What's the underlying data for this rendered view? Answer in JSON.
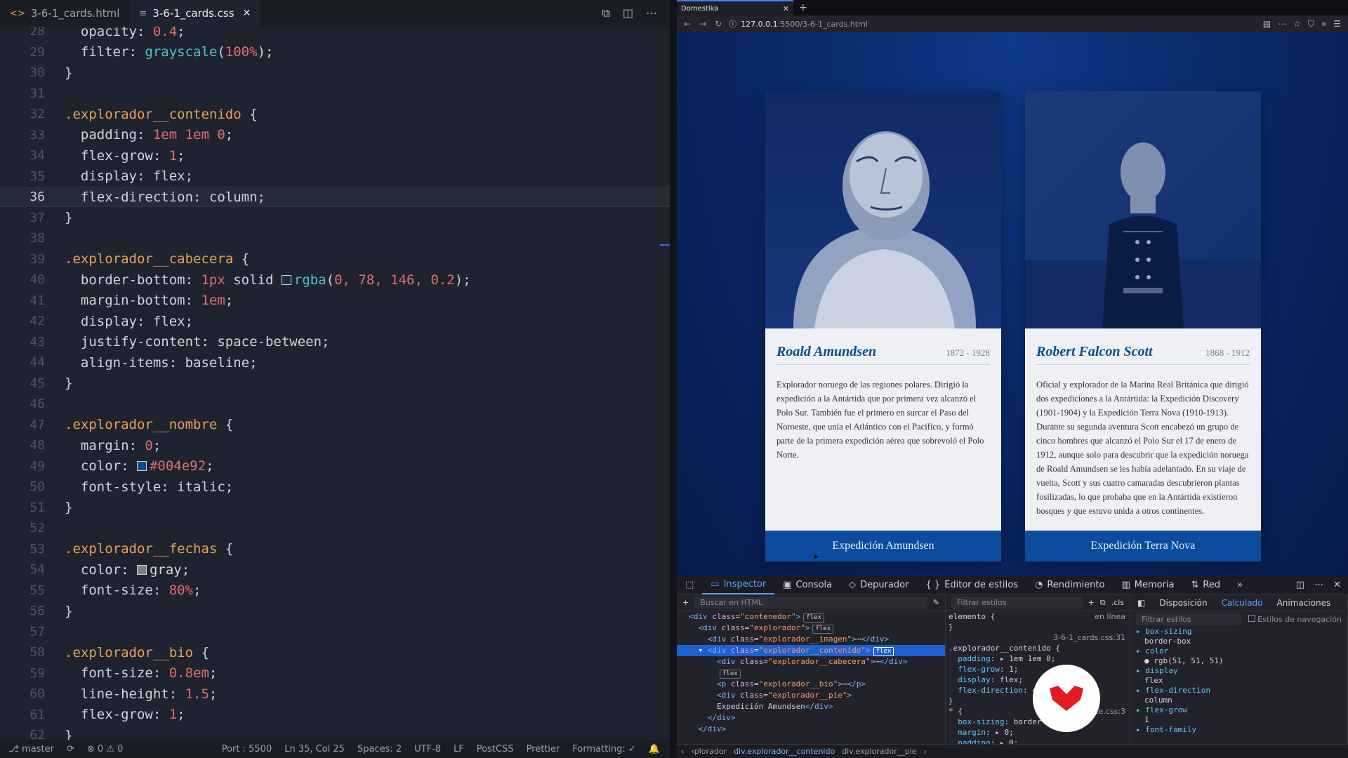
{
  "editor": {
    "tabs": [
      {
        "label": "3-6-1_cards.html",
        "active": false
      },
      {
        "label": "3-6-1_cards.css",
        "active": true
      }
    ],
    "lines": [
      {
        "n": "28",
        "html": "<span class='prop'>  opacity: </span><span class='num'>0.4</span><span class='br'>;</span>"
      },
      {
        "n": "29",
        "html": "<span class='prop'>  filter: </span><span class='fn'>grayscale</span><span class='br'>(</span><span class='num'>100%</span><span class='br'>);</span>"
      },
      {
        "n": "30",
        "html": "<span class='br'>}</span>"
      },
      {
        "n": "31",
        "html": ""
      },
      {
        "n": "32",
        "html": "<span class='sel'>.explorador__contenido</span><span class='br'> {</span>"
      },
      {
        "n": "33",
        "html": "<span class='prop'>  padding: </span><span class='num'>1em 1em 0</span><span class='br'>;</span>"
      },
      {
        "n": "34",
        "html": "<span class='prop'>  flex-grow: </span><span class='num'>1</span><span class='br'>;</span>"
      },
      {
        "n": "35",
        "html": "<span class='prop'>  display: flex;</span>"
      },
      {
        "n": "36",
        "html": "<span class='prop'>  flex-direction: column;</span>",
        "current": true
      },
      {
        "n": "37",
        "html": "<span class='br'>}</span>"
      },
      {
        "n": "38",
        "html": ""
      },
      {
        "n": "39",
        "html": "<span class='sel'>.explorador__cabecera</span><span class='br'> {</span>"
      },
      {
        "n": "40",
        "html": "<span class='prop'>  border-bottom: </span><span class='num'>1px</span><span class='prop'> solid </span><span class='swatch' style='background:rgba(0,78,146,0.2)'></span><span class='fn'>rgba</span><span class='br'>(</span><span class='num'>0, 78, 146, 0.2</span><span class='br'>);</span>"
      },
      {
        "n": "41",
        "html": "<span class='prop'>  margin-bottom: </span><span class='num'>1em</span><span class='br'>;</span>"
      },
      {
        "n": "42",
        "html": "<span class='prop'>  display: flex;</span>"
      },
      {
        "n": "43",
        "html": "<span class='prop'>  justify-content: space-between;</span>"
      },
      {
        "n": "44",
        "html": "<span class='prop'>  align-items: baseline;</span>"
      },
      {
        "n": "45",
        "html": "<span class='br'>}</span>"
      },
      {
        "n": "46",
        "html": ""
      },
      {
        "n": "47",
        "html": "<span class='sel'>.explorador__nombre</span><span class='br'> {</span>"
      },
      {
        "n": "48",
        "html": "<span class='prop'>  margin: </span><span class='num'>0</span><span class='br'>;</span>"
      },
      {
        "n": "49",
        "html": "<span class='prop'>  color: </span><span class='swatch' style='background:#004e92'></span><span class='num'>#004e92</span><span class='br'>;</span>"
      },
      {
        "n": "50",
        "html": "<span class='prop'>  font-style: italic;</span>"
      },
      {
        "n": "51",
        "html": "<span class='br'>}</span>"
      },
      {
        "n": "52",
        "html": ""
      },
      {
        "n": "53",
        "html": "<span class='sel'>.explorador__fechas</span><span class='br'> {</span>"
      },
      {
        "n": "54",
        "html": "<span class='prop'>  color: </span><span class='swatch' style='background:gray'></span><span class='prop'>gray;</span>"
      },
      {
        "n": "55",
        "html": "<span class='prop'>  font-size: </span><span class='num'>80%</span><span class='br'>;</span>"
      },
      {
        "n": "56",
        "html": "<span class='br'>}</span>"
      },
      {
        "n": "57",
        "html": ""
      },
      {
        "n": "58",
        "html": "<span class='sel'>.explorador__bio</span><span class='br'> {</span>"
      },
      {
        "n": "59",
        "html": "<span class='prop'>  font-size: </span><span class='num'>0.8em</span><span class='br'>;</span>"
      },
      {
        "n": "60",
        "html": "<span class='prop'>  line-height: </span><span class='num'>1.5</span><span class='br'>;</span>"
      },
      {
        "n": "61",
        "html": "<span class='prop'>  flex-grow: </span><span class='num'>1</span><span class='br'>;</span>"
      },
      {
        "n": "62",
        "html": "<span class='br'>}</span>"
      }
    ],
    "status": {
      "branch": "master",
      "errors": "0",
      "warnings": "0",
      "port": "Port : 5500",
      "cursor": "Ln 35, Col 25",
      "spaces": "Spaces: 2",
      "encoding": "UTF-8",
      "eol": "LF",
      "language": "PostCSS",
      "formatter": "Prettier",
      "formatting": "Formatting: ✓"
    }
  },
  "browser": {
    "tab_title": "Domestika",
    "url_host": "127.0.0.1",
    "url_path": ":5500/3-6-1_cards.html",
    "cards": [
      {
        "name": "Roald Amundsen",
        "dates": "1872 - 1928",
        "bio": "Explorador noruego de las regiones polares. Dirigió la expedición a la Antártida que por primera vez alcanzó el Polo Sur. También fue el primero en surcar el Paso del Noroeste, que unía el Atlántico con el Pacífico, y formó parte de la primera expedición aérea que sobrevoló el Polo Norte.",
        "footer": "Expedición Amundsen"
      },
      {
        "name": "Robert Falcon Scott",
        "dates": "1868 - 1912",
        "bio": "Oficial y explorador de la Marina Real Británica que dirigió dos expediciones a la Antártida: la Expedición Discovery (1901-1904) y la Expedición Terra Nova (1910-1913). Durante su segunda aventura Scott encabezó un grupo de cinco hombres que alcanzó el Polo Sur el 17 de enero de 1912, aunque solo para descubrir que la expedición noruega de Roald Amundsen se les había adelantado. En su viaje de vuelta, Scott y sus cuatro camaradas descubrieron plantas fosilizadas, lo que probaba que en la Antártida existieron bosques y que estuvo unida a otros continentes.",
        "footer": "Expedición Terra Nova"
      }
    ]
  },
  "devtools": {
    "tabs": [
      "Inspector",
      "Consola",
      "Depurador",
      "Editor de estilos",
      "Rendimiento",
      "Memoria",
      "Red"
    ],
    "html_search_placeholder": "Buscar en HTML",
    "styles_filter_placeholder": "Filtrar estilos",
    "cls_label": ".cls",
    "tree": [
      {
        "html": "  <span class='tag'>&lt;div</span> <span class='attr'>class</span>=<span class='aval'>\"contenedor\"</span><span class='tag'>&gt;</span><span class='badge'>flex</span>"
      },
      {
        "html": "    <span class='tag'>&lt;div</span> <span class='attr'>class</span>=<span class='aval'>\"explorador\"</span><span class='tag'>&gt;</span><span class='badge'>flex</span>"
      },
      {
        "html": "      <span class='tag'>&lt;div</span> <span class='attr'>class</span>=<span class='aval'>\"explorador__imagen\"</span><span class='tag'>&gt;</span>⋯<span class='tag'>&lt;/div&gt;</span>"
      },
      {
        "html": "    ▾ <span class='tag'>&lt;div</span> <span class='attr'>class</span>=<span class='aval'>\"explorador__contenido\"</span><span class='tag'>&gt;</span><span class='badge'>flex</span>",
        "selected": true
      },
      {
        "html": "        <span class='tag'>&lt;div</span> <span class='attr'>class</span>=<span class='aval'>\"explorador__cabecera\"</span><span class='tag'>&gt;</span>⋯<span class='tag'>&lt;/div&gt;</span>"
      },
      {
        "html": "        <span class='badge'>flex</span>"
      },
      {
        "html": "        <span class='tag'>&lt;p</span> <span class='attr'>class</span>=<span class='aval'>\"explorador__bio\"</span><span class='tag'>&gt;</span>⋯<span class='tag'>&lt;/p&gt;</span>"
      },
      {
        "html": "        <span class='tag'>&lt;div</span> <span class='attr'>class</span>=<span class='aval'>\"explorador__pie\"</span><span class='tag'>&gt;</span>"
      },
      {
        "html": "        Expedición Amundsen<span class='tag'>&lt;/div&gt;</span>"
      },
      {
        "html": "      <span class='tag'>&lt;/div&gt;</span>"
      },
      {
        "html": "    <span class='tag'>&lt;/div&gt;</span>"
      }
    ],
    "rules": [
      {
        "html": "elemento <span class='rval'>{</span><span class='src'>en línea</span>"
      },
      {
        "html": "<span class='rval'>}</span>"
      },
      {
        "html": "<span class='src'>3-6-1_cards.css:31</span>"
      },
      {
        "html": ".explorador__contenido <span class='rval'>{</span>"
      },
      {
        "html": "  <span class='rprop'>padding</span>: <span class='rval'>▸ 1em 1em 0;</span>"
      },
      {
        "html": "  <span class='rprop'>flex-grow</span>: <span class='rval'>1;</span>"
      },
      {
        "html": "  <span class='rprop'>display</span>: <span class='rval'>flex;</span>"
      },
      {
        "html": "  <span class='rprop'>flex-direction</span>: <span class='rval'>column;</span>"
      },
      {
        "html": "<span class='rval'>}</span>"
      },
      {
        "html": "* <span class='rval'>{</span><span class='src'>site.css:3</span>"
      },
      {
        "html": "  <span class='rprop'>box-sizing</span>: <span class='rval'>border-box;</span>"
      },
      {
        "html": "  <span class='rprop'>margin</span>: <span class='rval'>▸ 0;</span>"
      },
      {
        "html": "  <span class='rprop'>padding</span>: <span class='rval'>▸ 0;</span>"
      }
    ],
    "computed_tabs": [
      "Disposición",
      "Calculado",
      "Animaciones"
    ],
    "computed_filter_placeholder": "Filtrar estilos",
    "browser_styles_label": "Estilos de navegación",
    "computed": [
      {
        "k": "box-sizing",
        "v": "border-box"
      },
      {
        "k": "color",
        "v": "● rgb(51, 51, 51)"
      },
      {
        "k": "display",
        "v": "flex"
      },
      {
        "k": "flex-direction",
        "v": "column"
      },
      {
        "k": "flex-grow",
        "v": "1"
      },
      {
        "k": "font-family",
        "v": ""
      }
    ],
    "breadcrumbs": [
      "‹plorador",
      "div.explorador__contenido",
      "div.explorador__pie"
    ]
  }
}
